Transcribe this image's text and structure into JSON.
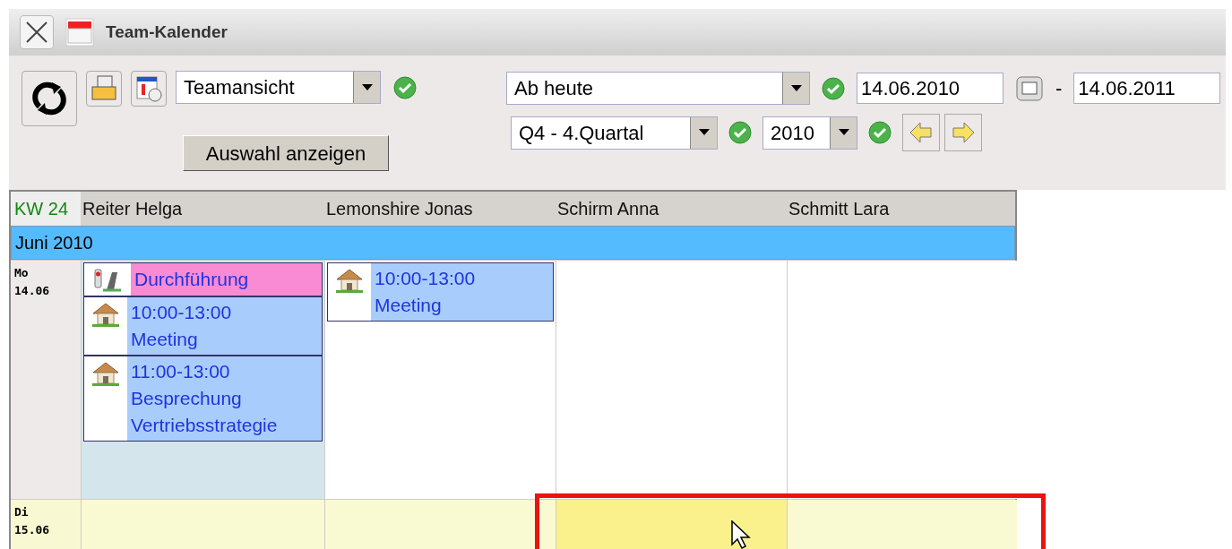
{
  "window": {
    "title": "Team-Kalender"
  },
  "toolbar": {
    "view_select": "Teamansicht",
    "show_button": "Auswahl anzeigen",
    "range_select": "Ab heute",
    "date_from": "14.06.2010",
    "separator": "-",
    "date_to": "14.06.2011",
    "quarter_select": "Q4 - 4.Quartal",
    "year_select": "2010"
  },
  "calendar": {
    "week_label": "KW 24",
    "columns": [
      "Reiter Helga",
      "Lemonshire Jonas",
      "Schirm Anna",
      "Schmitt Lara"
    ],
    "month": "Juni 2010",
    "days": [
      {
        "weekday": "Mo",
        "date": "14.06",
        "highlighted": false,
        "cells": [
          {
            "selected": true,
            "events": [
              {
                "kind": "task",
                "title": "Durchführung"
              },
              {
                "kind": "appointment",
                "time": "10:00-13:00",
                "title": "Meeting"
              },
              {
                "kind": "appointment",
                "time": "11:00-13:00",
                "title": "Besprechung Vertriebsstrategie"
              }
            ]
          },
          {
            "selected": false,
            "events": [
              {
                "kind": "appointment",
                "time": "10:00-13:00",
                "title": "Meeting"
              }
            ]
          },
          {
            "selected": false
          },
          {
            "selected": false
          }
        ]
      },
      {
        "weekday": "Di",
        "date": "15.06",
        "highlighted": true,
        "cells": [
          {
            "selected": false
          },
          {
            "selected": false
          },
          {
            "selected": true
          },
          {
            "selected": false
          }
        ]
      }
    ]
  }
}
